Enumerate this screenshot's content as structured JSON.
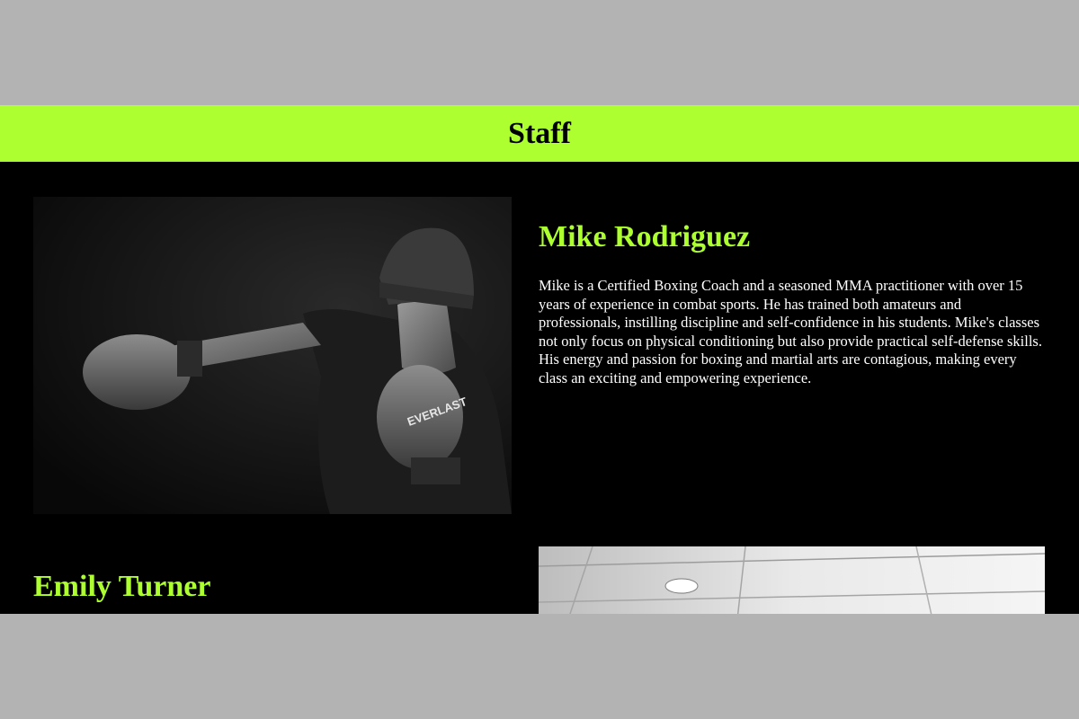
{
  "header": {
    "title": "Staff",
    "background": "#adff2f"
  },
  "staff": [
    {
      "name": "Mike Rodriguez",
      "bio": "Mike is a Certified Boxing Coach and a seasoned MMA practitioner with over 15 years of experience in combat sports. He has trained both amateurs and professionals, instilling discipline and self-confidence in his students. Mike's classes not only focus on physical conditioning but also provide practical self-defense skills. His energy and passion for boxing and martial arts are contagious, making every class an exciting and empowering experience.",
      "photo_glove_brand": "EVERLAST"
    },
    {
      "name": "Emily Turner"
    }
  ],
  "colors": {
    "accent": "#adff2f",
    "page_background": "#000000",
    "outer_background": "#b3b3b3",
    "body_text": "#ffffff"
  }
}
